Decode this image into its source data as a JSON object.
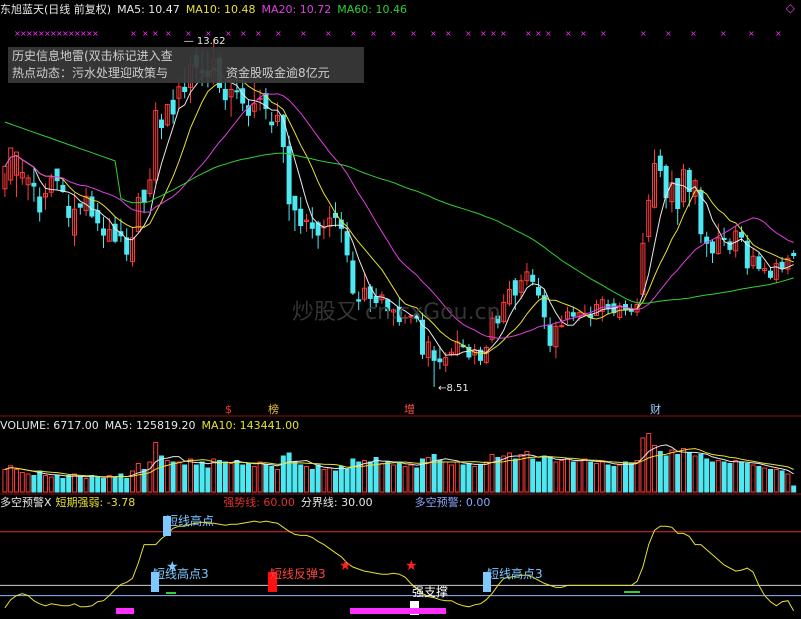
{
  "header": {
    "stock_name": "东旭蓝天(日线 前复权)",
    "ma5": "MA5: 10.47",
    "ma10": "MA10: 10.48",
    "ma20": "MA20: 10.72",
    "ma60": "MA60: 10.46",
    "diamond": "◇"
  },
  "news": {
    "line1": "历史信息地雷(双击标记进入查",
    "line2": "热点动态：污水处理迎政策与",
    "line2_tail": "资金股吸金逾8亿元"
  },
  "watermark": "炒股又 cn.cxGou.cn",
  "markers": {
    "high_label": "13.62",
    "low_label": "8.51",
    "event_s": "$",
    "event_bang": "榜",
    "event_zeng": "增",
    "event_cai": "财"
  },
  "volume_header": {
    "volume": "VOLUME: 6717.00",
    "ma5": "MA5: 125819.20",
    "ma10": "MA10: 143441.00"
  },
  "indicator_header": {
    "title": "多空预警X",
    "short_strength": "短期强弱: -3.78",
    "strong_line": "强势线: 60.00",
    "boundary": "分界线: 30.00",
    "warning": "多空预警: 0.00"
  },
  "indicator_labels": {
    "high1": "短线高点",
    "high2": "短线高点3",
    "rebound": "短线反弹3",
    "support": "强支撑",
    "high3": "短线高点3"
  },
  "colors": {
    "up": "#ff3a3a",
    "down": "#4ee8f2",
    "ma5": "#e8e8e8",
    "ma10": "#e8e030",
    "ma20": "#e040e0",
    "ma60": "#30d030",
    "strong": "#e03030",
    "boundary": "#d0d0d0",
    "short_strength": "#e8e030",
    "magenta_bar": "#ff30ff"
  },
  "chart_data": {
    "type": "candlestick",
    "title": "东旭蓝天(日线 前复权)",
    "y_range": [
      8.2,
      13.9
    ],
    "y_high": 13.62,
    "y_low": 8.51,
    "ma_last": {
      "MA5": 10.47,
      "MA10": 10.48,
      "MA20": 10.72,
      "MA60": 10.46
    },
    "volume_last": {
      "VOLUME": 6717.0,
      "MA5": 125819.2,
      "MA10": 143441.0
    },
    "indicator_last": {
      "短期强弱": -3.78,
      "强势线": 60.0,
      "分界线": 30.0,
      "多空预警": 0.0
    },
    "candles": [
      [
        11.42,
        11.75,
        11.65,
        11.3
      ],
      [
        11.55,
        12.02,
        11.85,
        11.48
      ],
      [
        11.62,
        11.96,
        11.9,
        11.3
      ],
      [
        11.58,
        11.66,
        11.85,
        11.48
      ],
      [
        11.48,
        11.58,
        11.63,
        11.25
      ],
      [
        11.5,
        11.46,
        11.72,
        11.23
      ],
      [
        11.3,
        11.08,
        11.44,
        10.94
      ],
      [
        11.3,
        11.35,
        11.5,
        11.11
      ],
      [
        11.37,
        11.58,
        11.64,
        11.3
      ],
      [
        11.71,
        11.54,
        11.71,
        11.4
      ],
      [
        11.47,
        11.38,
        11.56,
        11.36
      ],
      [
        11.16,
        11.0,
        11.34,
        10.86
      ],
      [
        10.74,
        11.12,
        11.36,
        10.58
      ],
      [
        11.2,
        11.15,
        11.2,
        11.04
      ],
      [
        11.1,
        11.31,
        11.43,
        11.02
      ],
      [
        11.3,
        11.02,
        11.39,
        10.99
      ],
      [
        11.1,
        10.92,
        11.21,
        10.8
      ],
      [
        10.83,
        10.74,
        11.01,
        10.55
      ],
      [
        10.65,
        10.82,
        10.99,
        10.65
      ],
      [
        10.9,
        10.65,
        11.01,
        10.62
      ],
      [
        10.79,
        10.73,
        10.98,
        10.64
      ],
      [
        10.7,
        10.46,
        10.84,
        10.36
      ],
      [
        10.35,
        10.7,
        10.86,
        10.28
      ],
      [
        10.79,
        11.29,
        11.36,
        10.8
      ],
      [
        11.4,
        11.22,
        11.4,
        11.06
      ],
      [
        11.35,
        11.55,
        11.72,
        11.3
      ],
      [
        11.55,
        12.57,
        12.69,
        11.5
      ],
      [
        12.43,
        12.32,
        12.52,
        12.15
      ],
      [
        12.36,
        12.66,
        12.66,
        12.33
      ],
      [
        12.72,
        12.52,
        12.88,
        12.38
      ],
      [
        12.75,
        12.92,
        13.06,
        12.6
      ],
      [
        12.91,
        12.85,
        13.2,
        12.75
      ],
      [
        12.91,
        13.25,
        13.38,
        12.68
      ],
      [
        13.38,
        13.21,
        13.5,
        13.0
      ],
      [
        13.16,
        13.12,
        13.44,
        12.93
      ],
      [
        13.15,
        13.07,
        13.43,
        12.91
      ],
      [
        13.0,
        13.32,
        13.62,
        12.95
      ],
      [
        13.34,
        12.91,
        13.41,
        12.83
      ],
      [
        12.88,
        12.73,
        13.03,
        12.58
      ],
      [
        12.77,
        12.88,
        13.07,
        12.48
      ],
      [
        12.86,
        12.85,
        13.17,
        12.74
      ],
      [
        12.89,
        12.68,
        13.1,
        12.56
      ],
      [
        12.64,
        12.5,
        12.74,
        12.34
      ],
      [
        12.56,
        12.67,
        12.98,
        12.46
      ],
      [
        12.75,
        12.75,
        12.88,
        12.57
      ],
      [
        12.82,
        12.6,
        12.9,
        12.44
      ],
      [
        12.4,
        12.36,
        12.55,
        12.24
      ],
      [
        12.41,
        12.5,
        12.69,
        12.34
      ],
      [
        12.5,
        12.04,
        12.52,
        11.8
      ],
      [
        12.04,
        11.2,
        12.2,
        10.95
      ],
      [
        11.31,
        11.11,
        11.31,
        10.8
      ],
      [
        11.12,
        10.88,
        11.3,
        10.76
      ],
      [
        10.94,
        10.96,
        11.05,
        10.79
      ],
      [
        10.92,
        10.84,
        11.15,
        10.69
      ],
      [
        10.92,
        10.74,
        10.95,
        10.54
      ],
      [
        10.85,
        10.86,
        10.97,
        10.68
      ],
      [
        10.87,
        10.99,
        11.17,
        10.71
      ],
      [
        11.06,
        11.0,
        11.22,
        10.86
      ],
      [
        10.96,
        10.84,
        11.08,
        10.63
      ],
      [
        10.79,
        10.45,
        10.93,
        10.34
      ],
      [
        10.36,
        9.89,
        10.5,
        9.86
      ],
      [
        9.79,
        9.77,
        9.91,
        9.64
      ],
      [
        9.8,
        9.96,
        10.18,
        9.76
      ],
      [
        9.98,
        9.81,
        10.02,
        9.61
      ],
      [
        9.84,
        9.75,
        9.96,
        9.68
      ],
      [
        9.79,
        9.86,
        9.91,
        9.73
      ],
      [
        9.79,
        9.63,
        9.81,
        9.51
      ],
      [
        9.61,
        9.64,
        9.66,
        9.41
      ],
      [
        9.68,
        9.47,
        9.82,
        9.41
      ],
      [
        9.52,
        9.53,
        9.57,
        9.44
      ],
      [
        9.55,
        9.55,
        9.58,
        9.44
      ],
      [
        9.58,
        9.52,
        9.61,
        9.46
      ],
      [
        9.49,
        8.99,
        9.6,
        8.92
      ],
      [
        8.94,
        9.17,
        9.26,
        8.81
      ],
      [
        9.04,
        8.9,
        9.11,
        8.51
      ],
      [
        8.92,
        8.88,
        9.11,
        8.77
      ],
      [
        8.83,
        8.94,
        9.02,
        8.73
      ],
      [
        8.99,
        9.02,
        9.08,
        8.96
      ],
      [
        8.99,
        9.17,
        9.34,
        8.96
      ],
      [
        9.12,
        9.1,
        9.21,
        9.08
      ],
      [
        9.09,
        8.95,
        9.14,
        8.91
      ],
      [
        8.98,
        9.04,
        9.14,
        8.84
      ],
      [
        9.05,
        8.9,
        9.1,
        8.83
      ],
      [
        8.87,
        9.09,
        9.12,
        8.84
      ],
      [
        9.21,
        9.52,
        9.62,
        9.16
      ],
      [
        9.55,
        9.45,
        9.61,
        9.37
      ],
      [
        9.47,
        9.75,
        9.87,
        9.44
      ],
      [
        9.73,
        9.94,
        10.07,
        9.7
      ],
      [
        10.07,
        9.86,
        10.11,
        9.64
      ],
      [
        9.9,
        10.07,
        10.16,
        9.8
      ],
      [
        10.07,
        10.2,
        10.33,
        10.0
      ],
      [
        10.15,
        10.06,
        10.24,
        10.0
      ],
      [
        9.97,
        9.86,
        10.11,
        9.81
      ],
      [
        9.85,
        9.54,
        9.94,
        9.36
      ],
      [
        9.42,
        9.12,
        9.53,
        9.02
      ],
      [
        9.1,
        9.4,
        9.47,
        8.93
      ],
      [
        9.4,
        9.41,
        9.56,
        9.38
      ],
      [
        9.51,
        9.61,
        9.69,
        9.43
      ],
      [
        9.6,
        9.55,
        9.69,
        9.48
      ],
      [
        9.54,
        9.6,
        9.63,
        9.48
      ],
      [
        9.56,
        9.59,
        9.72,
        9.56
      ],
      [
        9.57,
        9.53,
        9.69,
        9.4
      ],
      [
        9.56,
        9.72,
        9.79,
        9.56
      ],
      [
        9.62,
        9.79,
        9.84,
        9.47
      ],
      [
        9.72,
        9.66,
        9.79,
        9.57
      ],
      [
        9.73,
        9.6,
        9.81,
        9.55
      ],
      [
        9.53,
        9.7,
        9.75,
        9.49
      ],
      [
        9.72,
        9.64,
        9.78,
        9.56
      ],
      [
        9.65,
        9.62,
        9.73,
        9.56
      ],
      [
        9.61,
        9.72,
        9.81,
        9.55
      ],
      [
        9.87,
        10.62,
        10.77,
        9.83
      ],
      [
        10.72,
        11.25,
        11.34,
        10.64
      ],
      [
        11.15,
        11.79,
        12.0,
        11.13
      ],
      [
        11.9,
        11.69,
        12.0,
        11.59
      ],
      [
        11.75,
        11.29,
        11.78,
        11.13
      ],
      [
        11.23,
        11.51,
        11.69,
        11.07
      ],
      [
        11.57,
        11.13,
        11.57,
        10.89
      ],
      [
        11.23,
        11.7,
        11.79,
        11.15
      ],
      [
        11.69,
        11.38,
        11.73,
        11.16
      ],
      [
        11.31,
        11.54,
        11.57,
        11.19
      ],
      [
        11.39,
        10.76,
        11.45,
        10.62
      ],
      [
        10.71,
        10.62,
        10.79,
        10.42
      ],
      [
        10.64,
        10.48,
        10.68,
        10.33
      ],
      [
        10.47,
        10.7,
        10.91,
        10.45
      ],
      [
        10.69,
        10.68,
        10.85,
        10.58
      ],
      [
        10.64,
        10.53,
        10.69,
        10.46
      ],
      [
        10.51,
        10.8,
        10.87,
        10.41
      ],
      [
        10.78,
        10.71,
        10.87,
        10.64
      ],
      [
        10.65,
        10.26,
        10.74,
        10.16
      ],
      [
        10.29,
        10.43,
        10.55,
        10.24
      ],
      [
        10.42,
        10.25,
        10.48,
        10.21
      ],
      [
        10.22,
        10.25,
        10.34,
        10.17
      ],
      [
        10.21,
        10.12,
        10.26,
        10.09
      ],
      [
        10.09,
        10.32,
        10.39,
        10.04
      ],
      [
        10.34,
        10.25,
        10.42,
        10.19
      ],
      [
        10.24,
        10.4,
        10.45,
        10.16
      ],
      [
        10.47,
        10.44,
        10.52,
        10.39
      ]
    ],
    "volumes": [
      30,
      35,
      30,
      26,
      24,
      22,
      28,
      22,
      20,
      22,
      18,
      22,
      24,
      20,
      18,
      22,
      20,
      18,
      22,
      20,
      24,
      18,
      28,
      38,
      30,
      40,
      66,
      48,
      42,
      40,
      40,
      36,
      44,
      36,
      40,
      32,
      44,
      42,
      40,
      38,
      42,
      36,
      38,
      34,
      40,
      36,
      34,
      30,
      48,
      52,
      40,
      36,
      34,
      30,
      36,
      30,
      32,
      28,
      34,
      30,
      44,
      40,
      42,
      40,
      46,
      38,
      40,
      36,
      40,
      34,
      36,
      32,
      44,
      46,
      50,
      42,
      40,
      36,
      40,
      36,
      38,
      34,
      36,
      40,
      50,
      46,
      48,
      52,
      44,
      50,
      54,
      44,
      40,
      48,
      46,
      40,
      42,
      44,
      40,
      42,
      44,
      40,
      38,
      40,
      36,
      34,
      36,
      40,
      38,
      42,
      72,
      78,
      62,
      54,
      48,
      56,
      50,
      58,
      52,
      48,
      50,
      44,
      40,
      42,
      40,
      38,
      42,
      40,
      38,
      36,
      34,
      32,
      30,
      30,
      28,
      24,
      8
    ],
    "short_strength": [
      8,
      16,
      20,
      22,
      20,
      15,
      12,
      10,
      12,
      11,
      10,
      10,
      12,
      9,
      9,
      10,
      14,
      15,
      20,
      26,
      31,
      33,
      37,
      52,
      70,
      70,
      70,
      76,
      80,
      86,
      88,
      88,
      90,
      91,
      92,
      91,
      91,
      90,
      89,
      90,
      90,
      91,
      92,
      93,
      92,
      93,
      92,
      91,
      87,
      83,
      80,
      79,
      79,
      77,
      73,
      70,
      66,
      62,
      58,
      52,
      48,
      46,
      44,
      43,
      42,
      41,
      41,
      42,
      41,
      38,
      32,
      27,
      22,
      19,
      18,
      16,
      15,
      15,
      12,
      10,
      9,
      11,
      12,
      16,
      22,
      30,
      37,
      38,
      39,
      40,
      40,
      38,
      35,
      32,
      30,
      28,
      28,
      30,
      30,
      30,
      30,
      30,
      30,
      30,
      30,
      30,
      30,
      30,
      30,
      34,
      48,
      70,
      84,
      88,
      88,
      87,
      81,
      81,
      78,
      70,
      70,
      65,
      60,
      55,
      50,
      47,
      44,
      45,
      47,
      43,
      30,
      20,
      14,
      10,
      14,
      15,
      5
    ]
  }
}
